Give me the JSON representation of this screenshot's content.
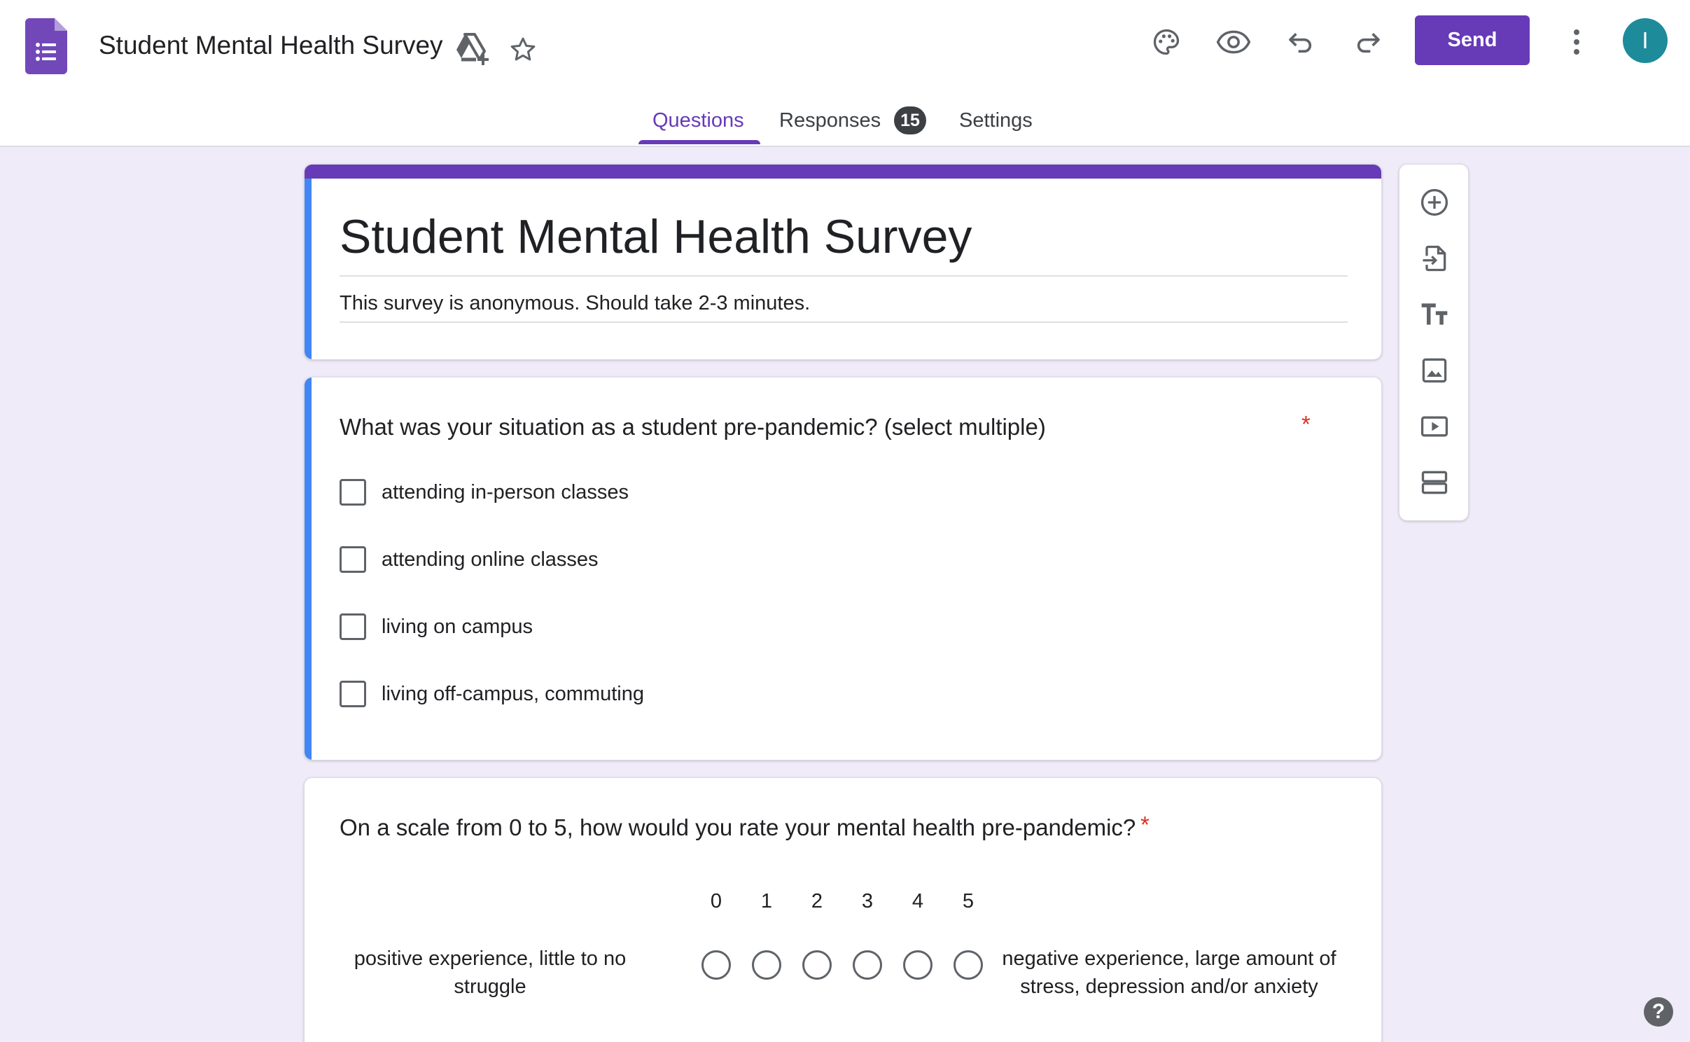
{
  "header": {
    "doc_title": "Student Mental Health Survey",
    "send_label": "Send",
    "avatar_initial": "I",
    "icons": [
      "forms-logo-icon",
      "move-to-drive-icon",
      "star-icon",
      "palette-icon",
      "preview-eye-icon",
      "undo-icon",
      "redo-icon",
      "more-vert-icon"
    ]
  },
  "tabs": {
    "questions": "Questions",
    "responses": "Responses",
    "responses_count": "15",
    "settings": "Settings"
  },
  "form": {
    "title": "Student Mental Health Survey",
    "description": "This survey is anonymous. Should take 2-3 minutes."
  },
  "question1": {
    "title": "What was your situation as a student pre-pandemic? (select multiple)",
    "required_mark": "*",
    "options": [
      "attending in-person classes",
      "attending online classes",
      "living on campus",
      "living off-campus, commuting"
    ]
  },
  "question2": {
    "title": "On a scale from 0 to 5, how would you rate your mental health pre-pandemic?",
    "required_mark": "*",
    "scale": [
      "0",
      "1",
      "2",
      "3",
      "4",
      "5"
    ],
    "low_label": "positive experience, little to no struggle",
    "high_label": "negative experience, large amount of stress, depression and/or anxiety"
  },
  "toolbar": {
    "tools": [
      "add-question-icon",
      "import-questions-icon",
      "add-title-icon",
      "add-image-icon",
      "add-video-icon",
      "add-section-icon"
    ]
  },
  "help": {
    "label": "?"
  },
  "colors": {
    "accent": "#673ab7",
    "active_border": "#4285f4",
    "background": "#f0ebf8",
    "required": "#d93025",
    "avatar": "#1e8b9a"
  }
}
